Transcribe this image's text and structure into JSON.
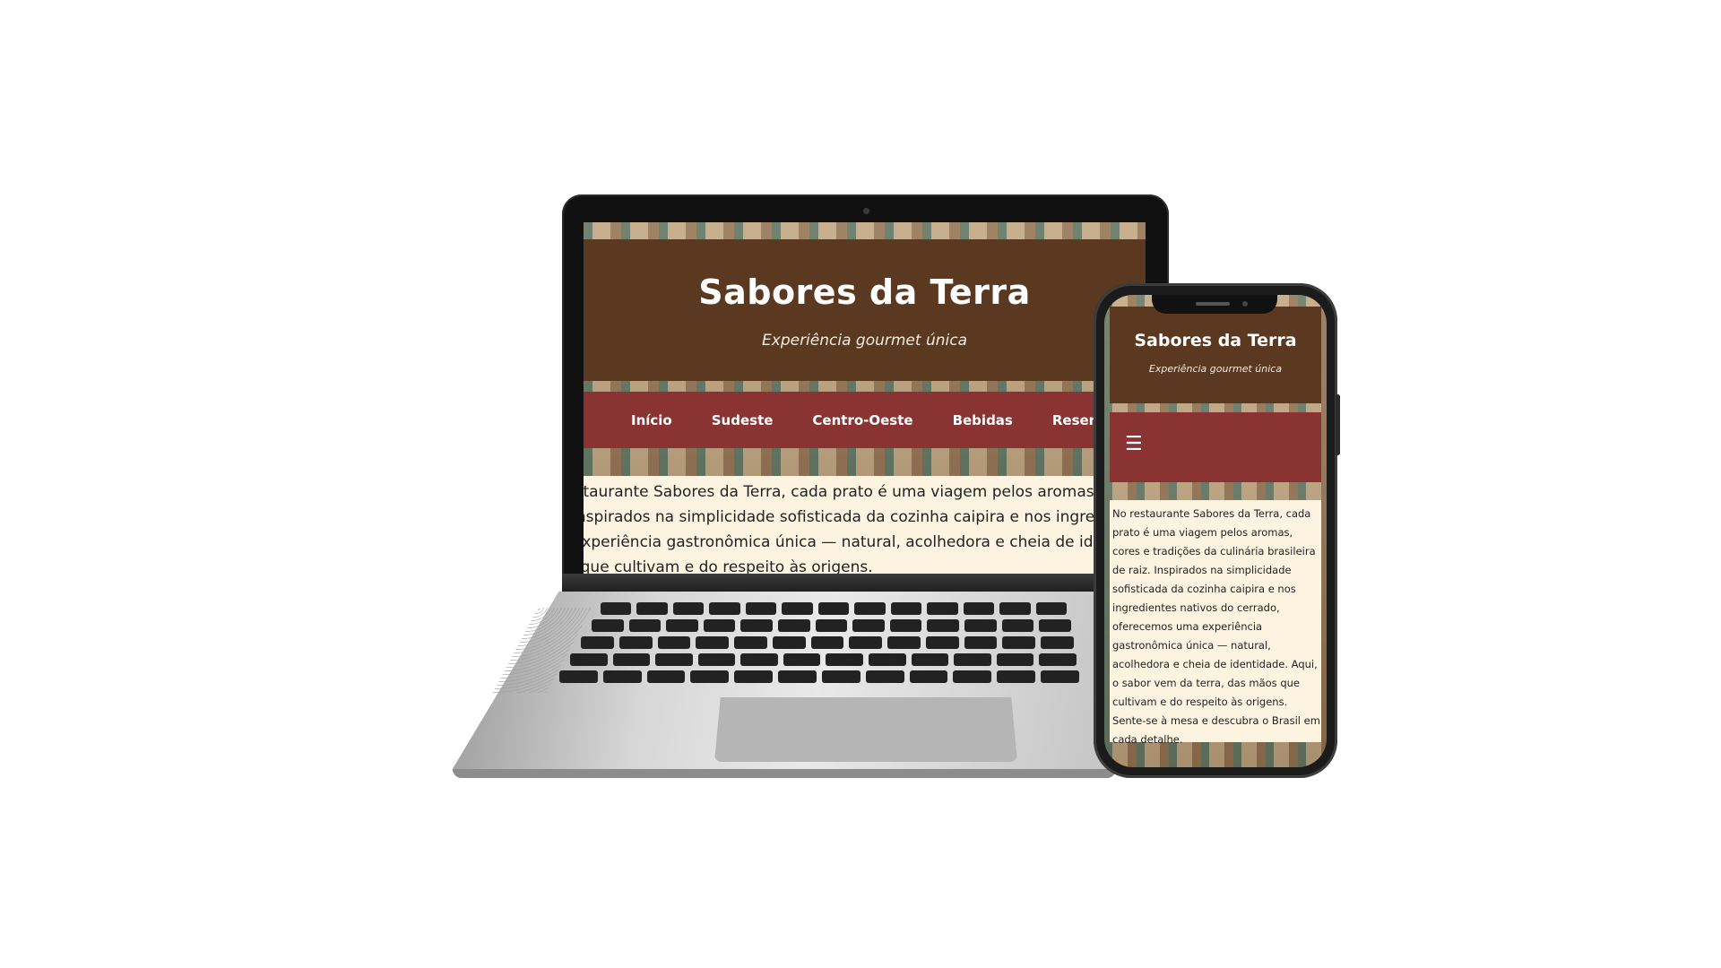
{
  "site": {
    "title": "Sabores da Terra",
    "subtitle": "Experiência gourmet única",
    "nav": [
      "Início",
      "Sudeste",
      "Centro-Oeste",
      "Bebidas",
      "Reserva"
    ],
    "menu_icon": "☰",
    "intro_desktop": "No restaurante Sabores da Terra, cada prato é uma viagem pelos aromas, cores e tradições da culinária brasileira de raiz. Inspirados na simplicidade sofisticada da cozinha caipira e nos ingredientes nativos do cerrado, oferecemos uma experiência gastronômica única — natural, acolhedora e cheia de identidade. Aqui, o sabor vem da terra, das mãos que cultivam e do respeito às origens.",
    "intro_mobile": "No restaurante Sabores da Terra, cada prato é uma viagem pelos aromas, cores e tradições da culinária brasileira de raiz. Inspirados na simplicidade sofisticada da cozinha caipira e nos ingredientes nativos do cerrado, oferecemos uma experiência gastronômica única — natural, acolhedora e cheia de identidade. Aqui, o sabor vem da terra, das mãos que cultivam e do respeito às origens. Sente-se à mesa e descubra o Brasil em cada detalhe."
  },
  "colors": {
    "header": "#5b3820",
    "nav": "#8a3333",
    "body": "#fdf3e1"
  }
}
